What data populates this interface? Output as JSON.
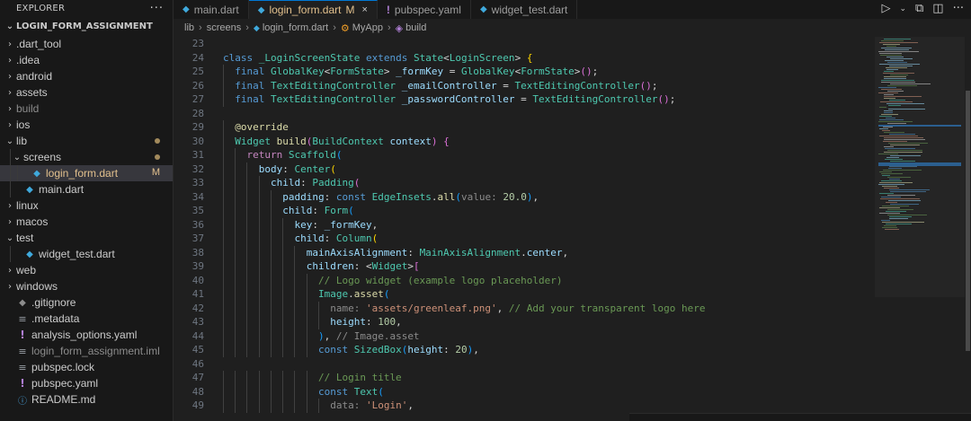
{
  "explorer": {
    "title": "EXPLORER",
    "more": "···",
    "project": "LOGIN_FORM_ASSIGNMENT",
    "items": [
      {
        "label": ".dart_tool",
        "kind": "folder",
        "depth": 0,
        "open": false
      },
      {
        "label": ".idea",
        "kind": "folder",
        "depth": 0,
        "open": false
      },
      {
        "label": "android",
        "kind": "folder",
        "depth": 0,
        "open": false
      },
      {
        "label": "assets",
        "kind": "folder",
        "depth": 0,
        "open": false
      },
      {
        "label": "build",
        "kind": "folder",
        "depth": 0,
        "open": false,
        "dim": true
      },
      {
        "label": "ios",
        "kind": "folder",
        "depth": 0,
        "open": false
      },
      {
        "label": "lib",
        "kind": "folder",
        "depth": 0,
        "open": true,
        "modified_dot": true
      },
      {
        "label": "screens",
        "kind": "folder",
        "depth": 1,
        "open": true,
        "modified_dot": true
      },
      {
        "label": "login_form.dart",
        "kind": "dart",
        "depth": 2,
        "selected": true,
        "badge": "M"
      },
      {
        "label": "main.dart",
        "kind": "dart",
        "depth": 1
      },
      {
        "label": "linux",
        "kind": "folder",
        "depth": 0,
        "open": false
      },
      {
        "label": "macos",
        "kind": "folder",
        "depth": 0,
        "open": false
      },
      {
        "label": "test",
        "kind": "folder",
        "depth": 0,
        "open": true
      },
      {
        "label": "widget_test.dart",
        "kind": "dart",
        "depth": 1
      },
      {
        "label": "web",
        "kind": "folder",
        "depth": 0,
        "open": false
      },
      {
        "label": "windows",
        "kind": "folder",
        "depth": 0,
        "open": false
      },
      {
        "label": ".gitignore",
        "kind": "git",
        "depth": 0
      },
      {
        "label": ".metadata",
        "kind": "lines",
        "depth": 0
      },
      {
        "label": "analysis_options.yaml",
        "kind": "excl",
        "depth": 0
      },
      {
        "label": "login_form_assignment.iml",
        "kind": "lines",
        "depth": 0,
        "dim": true
      },
      {
        "label": "pubspec.lock",
        "kind": "lines",
        "depth": 0
      },
      {
        "label": "pubspec.yaml",
        "kind": "excl",
        "depth": 0
      },
      {
        "label": "README.md",
        "kind": "info",
        "depth": 0
      }
    ]
  },
  "tabs": [
    {
      "label": "main.dart",
      "icon": "dart",
      "active": false
    },
    {
      "label": "login_form.dart",
      "icon": "dart",
      "active": true,
      "modified": "M",
      "close": "×"
    },
    {
      "label": "pubspec.yaml",
      "icon": "excl",
      "active": false
    },
    {
      "label": "widget_test.dart",
      "icon": "dart",
      "active": false
    }
  ],
  "breadcrumb": {
    "parts": [
      "lib",
      "screens",
      "login_form.dart",
      "MyApp",
      "build"
    ]
  },
  "editor": {
    "first_line": 23,
    "lines": [
      {
        "n": "23",
        "html": ""
      },
      {
        "n": "24",
        "html": "<span class='kw'>class</span> <span class='ty'>_LoginScreenState</span> <span class='kw'>extends</span> <span class='ty'>State</span><span class='pn'>&lt;</span><span class='ty'>LoginScreen</span><span class='pn'>&gt;</span> <span class='br1'>{</span>"
      },
      {
        "n": "25",
        "html": "  <span class='kw'>final</span> <span class='ty'>GlobalKey</span><span class='pn'>&lt;</span><span class='ty'>FormState</span><span class='pn'>&gt;</span> <span class='va'>_formKey</span> = <span class='ty'>GlobalKey</span><span class='pn'>&lt;</span><span class='ty'>FormState</span><span class='pn'>&gt;</span><span class='br2'>()</span>;"
      },
      {
        "n": "26",
        "html": "  <span class='kw'>final</span> <span class='ty'>TextEditingController</span> <span class='va'>_emailController</span> = <span class='ty'>TextEditingController</span><span class='br2'>()</span>;"
      },
      {
        "n": "27",
        "html": "  <span class='kw'>final</span> <span class='ty'>TextEditingController</span> <span class='va'>_passwordController</span> = <span class='ty'>TextEditingController</span><span class='br2'>()</span>;"
      },
      {
        "n": "28",
        "html": ""
      },
      {
        "n": "29",
        "html": "  <span class='ann'>@override</span>"
      },
      {
        "n": "30",
        "html": "  <span class='ty'>Widget</span> <span class='fn'>build</span><span class='br2'>(</span><span class='ty'>BuildContext</span> <span class='va'>context</span><span class='br2'>)</span> <span class='br2'>{</span>"
      },
      {
        "n": "31",
        "html": "    <span class='kw2'>return</span> <span class='ty'>Scaffold</span><span class='br3'>(</span>"
      },
      {
        "n": "32",
        "html": "      <span class='va'>body</span>: <span class='ty'>Center</span><span class='br1'>(</span>"
      },
      {
        "n": "33",
        "html": "        <span class='va'>child</span>: <span class='ty'>Padding</span><span class='br2'>(</span>"
      },
      {
        "n": "34",
        "html": "          <span class='va'>padding</span>: <span class='kw'>const</span> <span class='ty'>EdgeInsets</span>.<span class='fn'>all</span><span class='br3'>(</span><span class='hint'>value:</span> <span class='nu'>20.0</span><span class='br3'>)</span>,"
      },
      {
        "n": "35",
        "html": "          <span class='va'>child</span>: <span class='ty'>Form</span><span class='br3'>(</span>"
      },
      {
        "n": "36",
        "html": "            <span class='va'>key</span>: <span class='va'>_formKey</span>,"
      },
      {
        "n": "37",
        "html": "            <span class='va'>child</span>: <span class='ty'>Column</span><span class='br1'>(</span>"
      },
      {
        "n": "38",
        "html": "              <span class='va'>mainAxisAlignment</span>: <span class='ty'>MainAxisAlignment</span>.<span class='va'>center</span>,"
      },
      {
        "n": "39",
        "html": "              <span class='va'>children</span>: <span class='pn'>&lt;</span><span class='ty'>Widget</span><span class='pn'>&gt;</span><span class='br2'>[</span>"
      },
      {
        "n": "40",
        "html": "                <span class='cm'>// Logo widget (example logo placeholder)</span>"
      },
      {
        "n": "41",
        "html": "                <span class='ty'>Image</span>.<span class='fn'>asset</span><span class='br3'>(</span>"
      },
      {
        "n": "42",
        "html": "                  <span class='hint'>name:</span> <span class='st'>'assets/greenleaf.png'</span>, <span class='cm'>// Add your transparent logo here</span>"
      },
      {
        "n": "43",
        "html": "                  <span class='va'>height</span>: <span class='nu'>100</span>,"
      },
      {
        "n": "44",
        "html": "                <span class='br3'>)</span>, <span class='hint'>// Image.asset</span>"
      },
      {
        "n": "45",
        "html": "                <span class='kw'>const</span> <span class='ty'>SizedBox</span><span class='br3'>(</span><span class='va'>height</span>: <span class='nu'>20</span><span class='br3'>)</span>,"
      },
      {
        "n": "46",
        "html": ""
      },
      {
        "n": "47",
        "html": "                <span class='cm'>// Login title</span>"
      },
      {
        "n": "48",
        "html": "                <span class='kw'>const</span> <span class='ty'>Text</span><span class='br3'>(</span>"
      },
      {
        "n": "49",
        "html": "                  <span class='hint'>data:</span> <span class='st'>'Login'</span>,"
      }
    ]
  }
}
